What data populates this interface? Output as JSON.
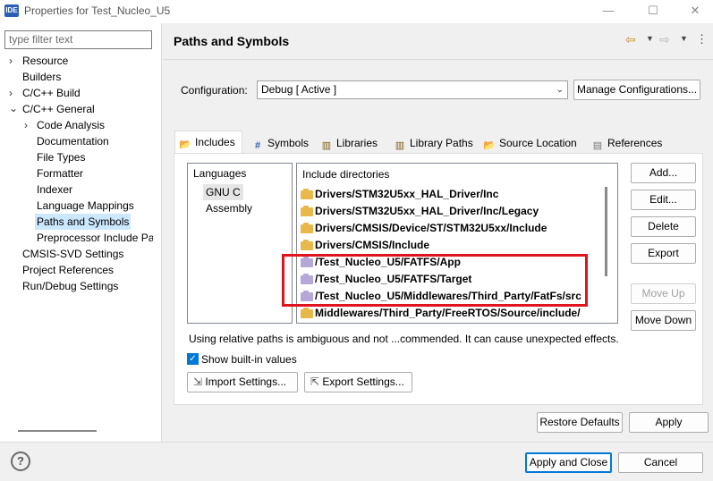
{
  "window": {
    "app_icon": "IDE",
    "title": "Properties for Test_Nucleo_U5",
    "minimize": "—",
    "maximize": "☐",
    "close": "✕"
  },
  "sidebar": {
    "filter_placeholder": "type filter text",
    "items": [
      {
        "label": "Resource",
        "arrow": "›"
      },
      {
        "label": "Builders",
        "arrow": ""
      },
      {
        "label": "C/C++ Build",
        "arrow": "›"
      },
      {
        "label": "C/C++ General",
        "arrow": "⌄"
      },
      {
        "label": "Code Analysis",
        "arrow": "›"
      },
      {
        "label": "Documentation",
        "arrow": ""
      },
      {
        "label": "File Types",
        "arrow": ""
      },
      {
        "label": "Formatter",
        "arrow": ""
      },
      {
        "label": "Indexer",
        "arrow": ""
      },
      {
        "label": "Language Mappings",
        "arrow": ""
      },
      {
        "label": "Paths and Symbols",
        "arrow": "",
        "selected": true
      },
      {
        "label": "Preprocessor Include Pat",
        "arrow": ""
      },
      {
        "label": "CMSIS-SVD Settings",
        "arrow": ""
      },
      {
        "label": "Project References",
        "arrow": ""
      },
      {
        "label": "Run/Debug Settings",
        "arrow": ""
      }
    ]
  },
  "header": {
    "title": "Paths and Symbols",
    "back_icon": "⇦",
    "forward_icon": "⇨",
    "menu_icon": "⋮"
  },
  "configuration": {
    "label": "Configuration:",
    "value": "Debug  [ Active ]",
    "manage_button": "Manage Configurations..."
  },
  "tabs": [
    {
      "label": "Includes",
      "icon": "includes-icon",
      "glyph": "📂",
      "active": true
    },
    {
      "label": "Symbols",
      "icon": "hash-icon",
      "glyph": "#"
    },
    {
      "label": "Libraries",
      "icon": "libraries-icon",
      "glyph": "▥"
    },
    {
      "label": "Library Paths",
      "icon": "library-paths-icon",
      "glyph": "▥"
    },
    {
      "label": "Source Location",
      "icon": "source-location-icon",
      "glyph": "📂"
    },
    {
      "label": "References",
      "icon": "references-icon",
      "glyph": "▤"
    }
  ],
  "languages": {
    "heading": "Languages",
    "items": [
      {
        "label": "GNU C",
        "selected": true
      },
      {
        "label": "Assembly"
      }
    ]
  },
  "includes": {
    "heading": "Include directories",
    "rows": [
      {
        "path": "Drivers/STM32U5xx_HAL_Driver/Inc",
        "kind": "folder"
      },
      {
        "path": "Drivers/STM32U5xx_HAL_Driver/Inc/Legacy",
        "kind": "folder"
      },
      {
        "path": "Drivers/CMSIS/Device/ST/STM32U5xx/Include",
        "kind": "folder"
      },
      {
        "path": "Drivers/CMSIS/Include",
        "kind": "folder"
      },
      {
        "path": "/Test_Nucleo_U5/FATFS/App",
        "kind": "project"
      },
      {
        "path": "/Test_Nucleo_U5/FATFS/Target",
        "kind": "project"
      },
      {
        "path": "/Test_Nucleo_U5/Middlewares/Third_Party/FatFs/src",
        "kind": "project"
      },
      {
        "path": "Middlewares/Third_Party/FreeRTOS/Source/include/",
        "kind": "folder"
      }
    ]
  },
  "side_buttons": {
    "add": "Add...",
    "edit": "Edit...",
    "delete": "Delete",
    "export": "Export",
    "move_up": "Move Up",
    "move_down": "Move Down"
  },
  "note": "Using relative paths is ambiguous and not ...commended. It can cause unexpected effects.",
  "show_builtin": {
    "label": "Show built-in values",
    "checked": true
  },
  "import_button": "Import Settings...",
  "export_settings_button": "Export Settings...",
  "restore_defaults": "Restore Defaults",
  "apply": "Apply",
  "apply_and_close": "Apply and Close",
  "cancel": "Cancel",
  "help_icon": "?",
  "colors": {
    "accent": "#0078d7",
    "highlight": "#e0141e",
    "selection": "#cce8ff"
  }
}
